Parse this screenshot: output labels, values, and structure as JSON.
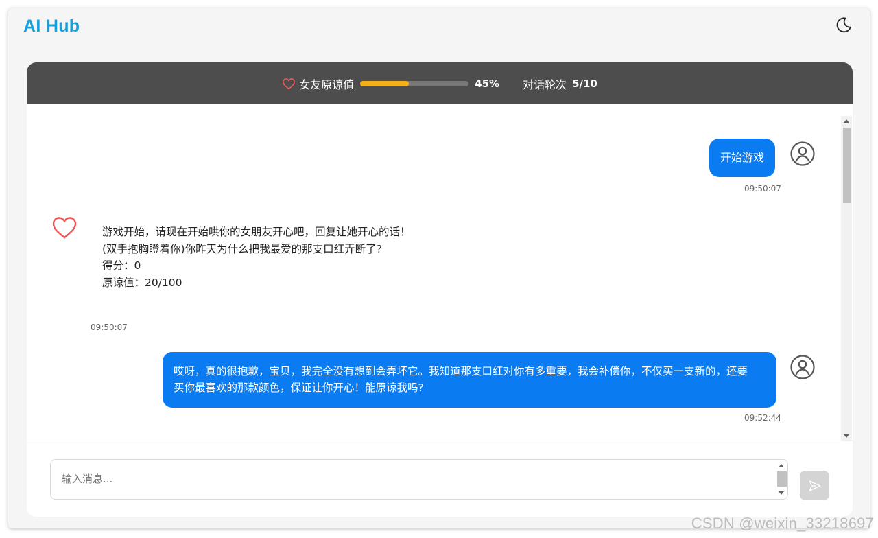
{
  "app": {
    "brand": "AI Hub",
    "accent_color": "#14a0de"
  },
  "header": {
    "theme_toggle_icon": "moon-icon"
  },
  "status_bar": {
    "heart_icon": "heart-icon",
    "forgiveness_label": "女友原谅值",
    "forgiveness_progress": 0.45,
    "forgiveness_percent": "45%",
    "rounds_label": "对话轮次",
    "rounds_value": "5/10",
    "progress_color": "#f5b017"
  },
  "messages": [
    {
      "role": "user",
      "text": "开始游戏",
      "time": "09:50:07"
    },
    {
      "role": "ai",
      "lines": [
        "游戏开始，请现在开始哄你的女朋友开心吧，回复让她开心的话！",
        "(双手抱胸瞪着你)你昨天为什么把我最爱的那支口红弄断了?",
        "得分：0",
        "原谅值：20/100"
      ],
      "time": "09:50:07"
    },
    {
      "role": "user",
      "lines": [
        "哎呀，真的很抱歉，宝贝，我完全没有想到会弄坏它。我知道那支口红对你有多重要，我会补偿你，不仅买一支新的，还要",
        "买你最喜欢的那款颜色，保证让你开心！能原谅我吗?"
      ],
      "time": "09:52:44"
    }
  ],
  "composer": {
    "placeholder": "输入消息...",
    "send_icon": "send-icon"
  },
  "user_bubble_color": "#0a7bf0",
  "watermark": "CSDN @weixin_33218697"
}
